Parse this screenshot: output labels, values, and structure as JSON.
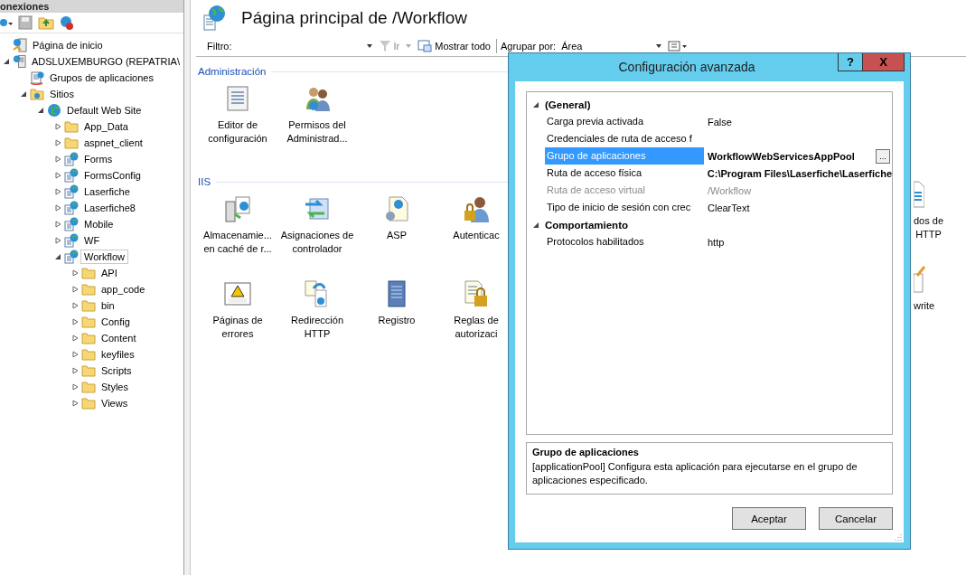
{
  "connections": {
    "title": "onexiones",
    "tree": [
      {
        "label": "Página de inicio",
        "kind": "home",
        "selected": false
      },
      {
        "label": "ADSLUXEMBURGO (REPATRIA\\",
        "kind": "server",
        "selected": false,
        "expanded": true,
        "children": [
          {
            "label": "Grupos de aplicaciones",
            "kind": "pool",
            "selected": false
          },
          {
            "label": "Sitios",
            "kind": "sites",
            "selected": false,
            "expanded": true,
            "children": [
              {
                "label": "Default Web Site",
                "kind": "site",
                "selected": false,
                "expanded": true,
                "children": [
                  {
                    "label": "App_Data",
                    "kind": "folder",
                    "selected": false,
                    "expanded": false
                  },
                  {
                    "label": "aspnet_client",
                    "kind": "folder",
                    "selected": false,
                    "expanded": false
                  },
                  {
                    "label": "Forms",
                    "kind": "app",
                    "selected": false,
                    "expanded": false
                  },
                  {
                    "label": "FormsConfig",
                    "kind": "app",
                    "selected": false,
                    "expanded": false
                  },
                  {
                    "label": "Laserfiche",
                    "kind": "app",
                    "selected": false,
                    "expanded": false
                  },
                  {
                    "label": "Laserfiche8",
                    "kind": "app",
                    "selected": false,
                    "expanded": false
                  },
                  {
                    "label": "Mobile",
                    "kind": "app",
                    "selected": false,
                    "expanded": false
                  },
                  {
                    "label": "WF",
                    "kind": "app",
                    "selected": false,
                    "expanded": false
                  },
                  {
                    "label": "Workflow",
                    "kind": "app",
                    "selected": true,
                    "expanded": true,
                    "children": [
                      {
                        "label": "API",
                        "kind": "folder",
                        "selected": false,
                        "expanded": false
                      },
                      {
                        "label": "app_code",
                        "kind": "folder",
                        "selected": false,
                        "expanded": false
                      },
                      {
                        "label": "bin",
                        "kind": "folder",
                        "selected": false,
                        "expanded": false
                      },
                      {
                        "label": "Config",
                        "kind": "folder",
                        "selected": false,
                        "expanded": false
                      },
                      {
                        "label": "Content",
                        "kind": "folder",
                        "selected": false,
                        "expanded": false
                      },
                      {
                        "label": "keyfiles",
                        "kind": "folder",
                        "selected": false,
                        "expanded": false
                      },
                      {
                        "label": "Scripts",
                        "kind": "folder",
                        "selected": false,
                        "expanded": false
                      },
                      {
                        "label": "Styles",
                        "kind": "folder",
                        "selected": false,
                        "expanded": false
                      },
                      {
                        "label": "Views",
                        "kind": "folder",
                        "selected": false,
                        "expanded": false
                      }
                    ]
                  }
                ]
              }
            ]
          }
        ]
      }
    ]
  },
  "page": {
    "title": "Página principal de /Workflow"
  },
  "toolbar": {
    "filter_label": "Filtro:",
    "go_label": "Ir",
    "show_all": "Mostrar todo",
    "group_label": "Agrupar por:",
    "group_value": "Área"
  },
  "sections": [
    {
      "title": "Administración",
      "items": [
        {
          "kind": "editor",
          "lines": [
            "Editor de",
            "configuración"
          ]
        },
        {
          "kind": "users",
          "lines": [
            "Permisos del",
            "Administrad..."
          ]
        }
      ]
    },
    {
      "title": "IIS",
      "items": [
        {
          "kind": "cache",
          "lines": [
            "Almacenamie...",
            "en caché de r..."
          ]
        },
        {
          "kind": "handler",
          "lines": [
            "Asignaciones de",
            "controlador"
          ]
        },
        {
          "kind": "asp",
          "lines": [
            "ASP"
          ]
        },
        {
          "kind": "auth",
          "lines": [
            "Autenticac"
          ]
        },
        {
          "kind": "error",
          "lines": [
            "Páginas de",
            "errores"
          ]
        },
        {
          "kind": "redirect",
          "lines": [
            "Redirección",
            "HTTP"
          ]
        },
        {
          "kind": "log",
          "lines": [
            "Registro"
          ]
        },
        {
          "kind": "rules",
          "lines": [
            "Reglas de",
            "autorizaci"
          ]
        }
      ]
    }
  ],
  "edge_items": [
    {
      "kind": "doc",
      "lines": [
        "dos de",
        "HTTP"
      ]
    },
    {
      "kind": "rewrite",
      "lines": [
        "write"
      ]
    }
  ],
  "dialog": {
    "title": "Configuración avanzada",
    "help": "?",
    "close": "X",
    "categories": [
      {
        "name": "(General)",
        "expanded": true,
        "properties": [
          {
            "name": "Carga previa activada",
            "value": "False",
            "selected": false,
            "disabled": false,
            "bold": false
          },
          {
            "name": "Credenciales de ruta de acceso f",
            "selected": false,
            "disabled": false
          },
          {
            "name": "Grupo de aplicaciones",
            "value": "WorkflowWebServicesAppPool",
            "selected": true,
            "disabled": false,
            "bold": true,
            "button": "..."
          },
          {
            "name": "Ruta de acceso física",
            "value": "C:\\Program Files\\Laserfiche\\Laserfiche",
            "selected": false,
            "disabled": false,
            "bold": true
          },
          {
            "name": "Ruta de acceso virtual",
            "value": "/Workflow",
            "selected": false,
            "disabled": true,
            "bold": false
          },
          {
            "name": "Tipo de inicio de sesión con crec",
            "value": "ClearText",
            "selected": false,
            "disabled": false,
            "bold": false
          }
        ]
      },
      {
        "name": "Comportamiento",
        "expanded": true,
        "properties": [
          {
            "name": "Protocolos habilitados",
            "value": "http",
            "selected": false,
            "disabled": false,
            "bold": false
          }
        ]
      }
    ],
    "description": {
      "title": "Grupo de aplicaciones",
      "text": "[applicationPool] Configura esta aplicación para ejecutarse en el grupo de aplicaciones especificado."
    },
    "buttons": [
      "Aceptar",
      "Cancelar"
    ]
  }
}
